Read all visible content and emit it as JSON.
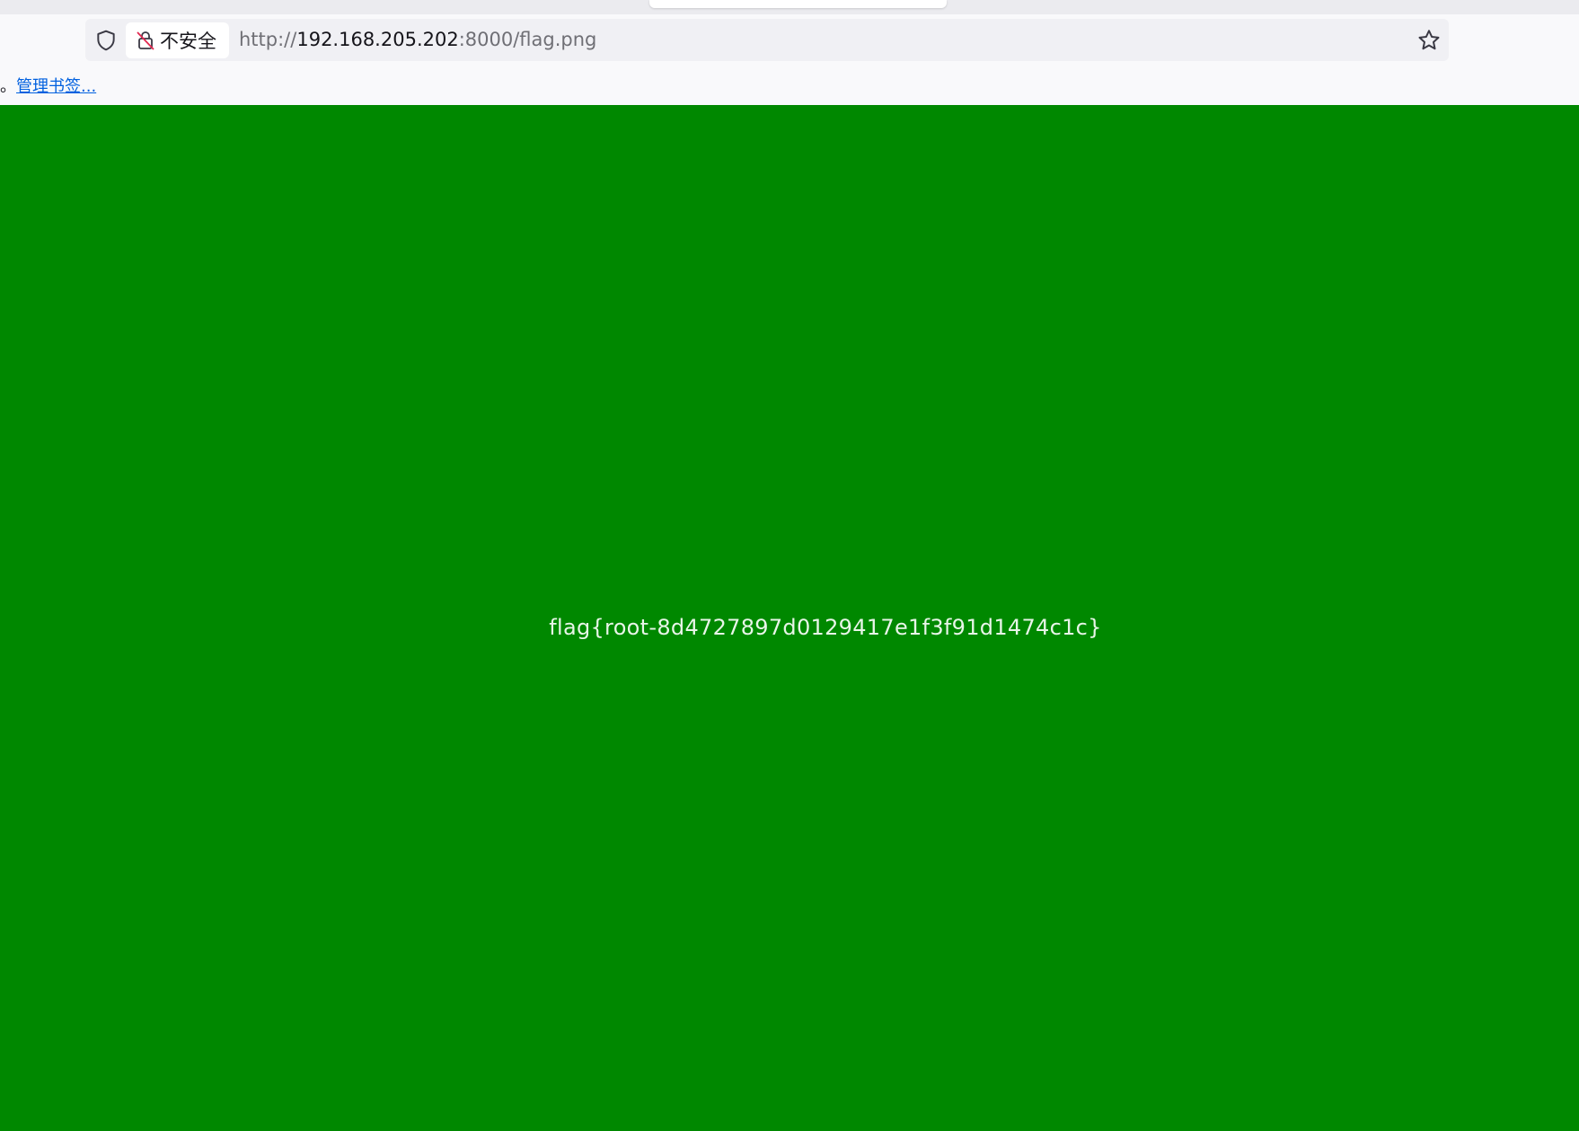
{
  "toolbar": {
    "security_label": "不安全",
    "url_scheme": "http://",
    "url_host": "192.168.205.202",
    "url_rest": ":8000/flag.png",
    "icons": {
      "tracking": "shield-icon",
      "security": "insecure-lock-icon",
      "bookmark": "star-icon"
    }
  },
  "bookmarks": {
    "prefix": "。",
    "manage_link": "管理书签..."
  },
  "content": {
    "flag_text": "flag{root-8d4727897d0129417e1f3f91d1474c1c}",
    "background_color": "#008800"
  }
}
